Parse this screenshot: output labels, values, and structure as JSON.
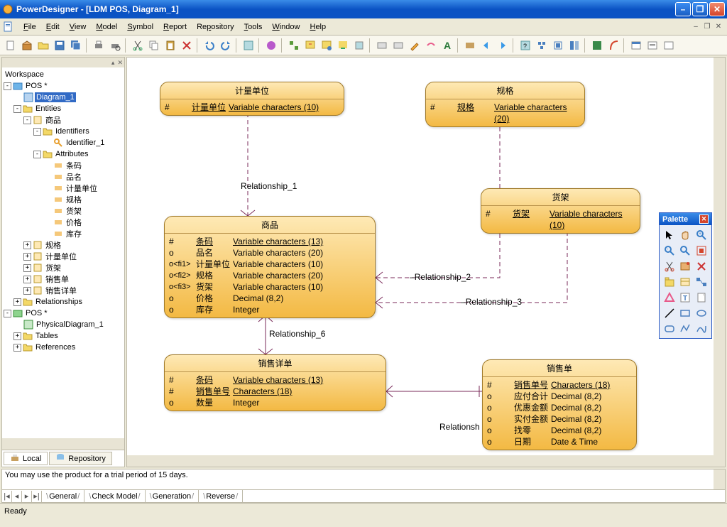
{
  "window": {
    "title": "PowerDesigner - [LDM POS, Diagram_1]"
  },
  "menu": {
    "file": "File",
    "edit": "Edit",
    "view": "View",
    "model": "Model",
    "symbol": "Symbol",
    "report": "Report",
    "repository": "Repository",
    "tools": "Tools",
    "window": "Window",
    "help": "Help"
  },
  "sidebar": {
    "root": "Workspace",
    "model1": "POS *",
    "diagram1": "Diagram_1",
    "entities": "Entities",
    "entity_sp": "商品",
    "identifiers": "Identifiers",
    "identifier1": "Identifier_1",
    "attributes": "Attributes",
    "attr_tm": "条码",
    "attr_pm": "品名",
    "attr_jldw": "计量单位",
    "attr_gg": "规格",
    "attr_hj": "货架",
    "attr_jg": "价格",
    "attr_kc": "库存",
    "ent_gg": "规格",
    "ent_jldw": "计量单位",
    "ent_hj": "货架",
    "ent_xsd": "销售单",
    "ent_xsxd": "销售详单",
    "relationships": "Relationships",
    "model2": "POS *",
    "pdiag": "PhysicalDiagram_1",
    "tables": "Tables",
    "refs": "References",
    "tab_local": "Local",
    "tab_repo": "Repository"
  },
  "entities": {
    "jldw": {
      "title": "计量单位",
      "r1_m": "#",
      "r1_n": "计量单位",
      "r1_t": "Variable characters (10)"
    },
    "gg": {
      "title": "规格",
      "r1_m": "#",
      "r1_n": "规格",
      "r1_t": "Variable characters (20)"
    },
    "hj": {
      "title": "货架",
      "r1_m": "#",
      "r1_n": "货架",
      "r1_t": "Variable characters (10)"
    },
    "sp": {
      "title": "商品",
      "r1_m": "#",
      "r1_n": "条码",
      "r1_t": "Variable characters (13)",
      "r2_m": "o",
      "r2_n": "品名",
      "r2_t": "Variable characters (20)",
      "r3_m": "o<fi1>",
      "r3_n": "计量单位",
      "r3_t": "Variable characters (10)",
      "r4_m": "o<fi2>",
      "r4_n": "规格",
      "r4_t": "Variable characters (20)",
      "r5_m": "o<fi3>",
      "r5_n": "货架",
      "r5_t": "Variable characters (10)",
      "r6_m": "o",
      "r6_n": "价格",
      "r6_t": "Decimal (8,2)",
      "r7_m": "o",
      "r7_n": "库存",
      "r7_t": "Integer"
    },
    "xsxd": {
      "title": "销售详单",
      "r1_m": "#",
      "r1_n": "条码",
      "r1_t": "Variable characters (13)",
      "r2_m": "#",
      "r2_n": "销售单号",
      "r2_t": "Characters (18)",
      "r3_m": "o",
      "r3_n": "数量",
      "r3_t": "Integer"
    },
    "xsd": {
      "title": "销售单",
      "r1_m": "#",
      "r1_n": "销售单号",
      "r1_t": "Characters (18)",
      "r2_m": "o",
      "r2_n": "应付合计",
      "r2_t": "Decimal (8,2)",
      "r3_m": "o",
      "r3_n": "优惠金额",
      "r3_t": "Decimal (8,2)",
      "r4_m": "o",
      "r4_n": "实付金额",
      "r4_t": "Decimal (8,2)",
      "r5_m": "o",
      "r5_n": "找零",
      "r5_t": "Decimal (8,2)",
      "r6_m": "o",
      "r6_n": "日期",
      "r6_t": "Date & Time"
    }
  },
  "rels": {
    "r1": "Relationship_1",
    "r2": "Relationship_2",
    "r3": "Relationship_3",
    "r6": "Relationship_6",
    "r_trunc": "Relationsh"
  },
  "palette_title": "Palette",
  "bottom": {
    "message": "You may use the product for a trial period of 15 days.",
    "tabs": {
      "general": "General",
      "check": "Check Model",
      "gen": "Generation",
      "rev": "Reverse"
    }
  },
  "status": "Ready"
}
